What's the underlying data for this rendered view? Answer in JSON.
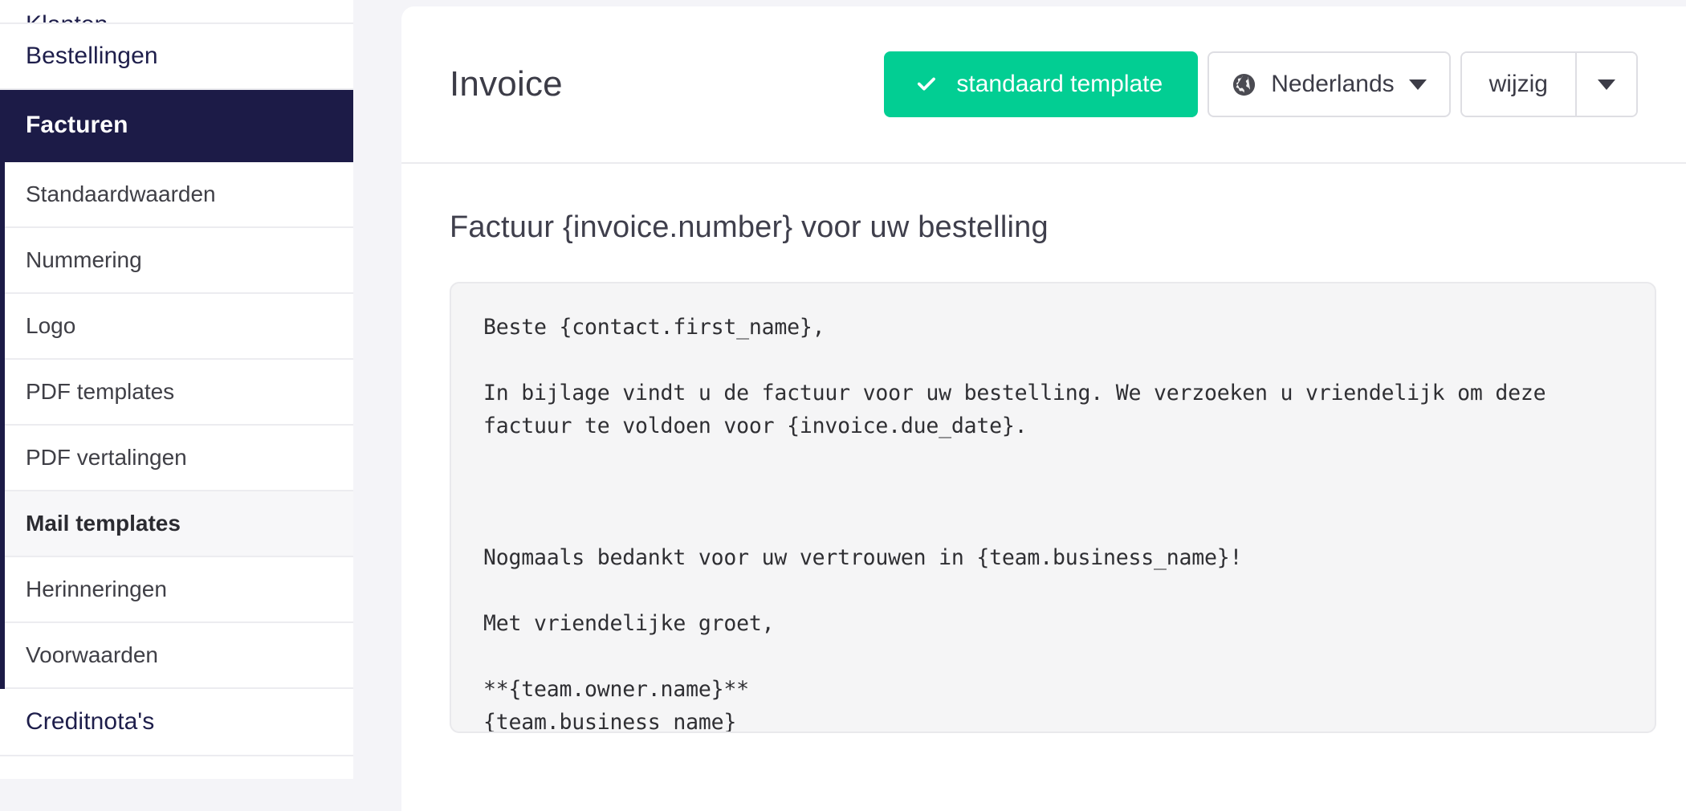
{
  "sidebar": {
    "clipped_top_item": {
      "label": "Klanten"
    },
    "items": [
      {
        "label": "Bestellingen",
        "type": "top",
        "state": "default"
      },
      {
        "label": "Facturen",
        "type": "top",
        "state": "active"
      }
    ],
    "sub_items": [
      {
        "label": "Standaardwaarden",
        "state": "default"
      },
      {
        "label": "Nummering",
        "state": "default"
      },
      {
        "label": "Logo",
        "state": "default"
      },
      {
        "label": "PDF templates",
        "state": "default"
      },
      {
        "label": "PDF vertalingen",
        "state": "default"
      },
      {
        "label": "Mail templates",
        "state": "selected"
      },
      {
        "label": "Herinneringen",
        "state": "default"
      },
      {
        "label": "Voorwaarden",
        "state": "default"
      }
    ],
    "trailing_items": [
      {
        "label": "Creditnota's",
        "type": "top",
        "state": "default"
      }
    ]
  },
  "header": {
    "title": "Invoice",
    "default_template_button": {
      "label": "standaard template",
      "icon": "check-icon"
    },
    "language_selector": {
      "label": "Nederlands",
      "icon": "globe-icon",
      "caret": "chevron-down-icon"
    },
    "edit_split_button": {
      "label": "wijzig",
      "caret": "chevron-down-icon"
    }
  },
  "main": {
    "subject": "Factuur {invoice.number} voor uw bestelling",
    "body": "Beste {contact.first_name},\n\nIn bijlage vindt u de factuur voor uw bestelling. We verzoeken u vriendelijk om deze factuur te voldoen voor {invoice.due_date}.\n\n\n\nNogmaals bedankt voor uw vertrouwen in {team.business_name}!\n\nMet vriendelijke groet,\n\n**{team.owner.name}**\n{team.business_name}"
  },
  "colors": {
    "sidebar_active_bg": "#1c1b47",
    "accent_green": "#02ce93",
    "page_bg": "#f4f4f8",
    "editor_bg": "#f5f5f6",
    "text_navy": "#1e1e4b"
  }
}
